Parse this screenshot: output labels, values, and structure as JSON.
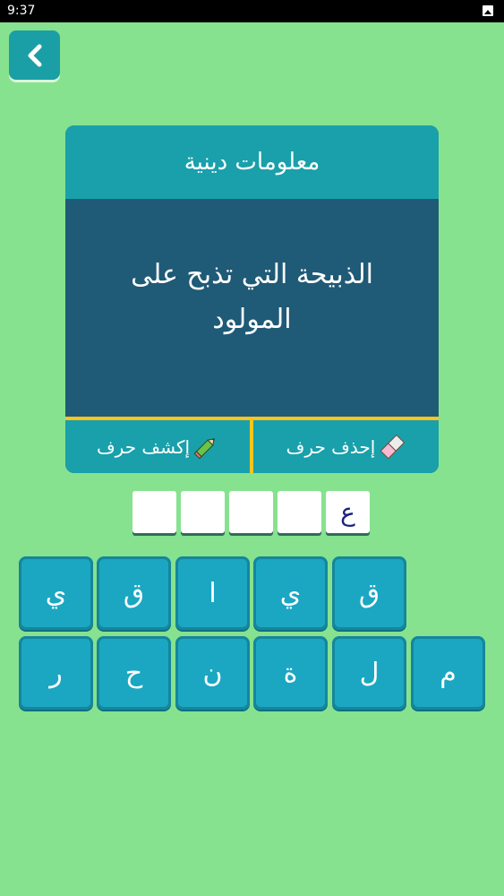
{
  "status_bar": {
    "time": "9:37"
  },
  "category": "معلومات دينية",
  "question": "الذبيحة التي تذبح على المولود",
  "buttons": {
    "reveal_label": "إكشف حرف",
    "delete_label": "إحذف حرف"
  },
  "answer_boxes": [
    "ع",
    "",
    "",
    "",
    ""
  ],
  "letter_rows": [
    [
      "ق",
      "ي",
      "ا",
      "ق",
      "ي"
    ],
    [
      "م",
      "ل",
      "ة",
      "ن",
      "ح",
      "ر"
    ]
  ],
  "colors": {
    "background": "#86e28e",
    "teal": "#19a0ab",
    "navy": "#1f5a76",
    "yellow": "#ffc51a",
    "tile": "#1ba7c2"
  },
  "icons": [
    "chevron-left-icon",
    "pencil-icon",
    "eraser-icon",
    "image-icon"
  ]
}
